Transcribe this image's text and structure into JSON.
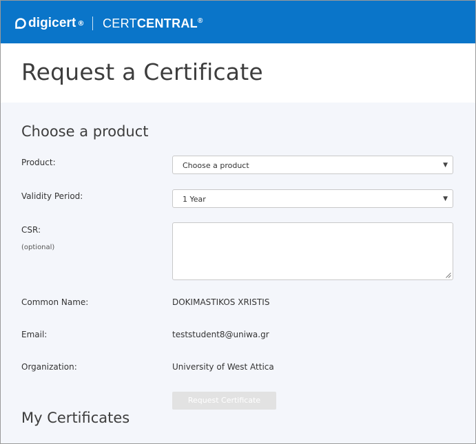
{
  "header": {
    "logo_text": "digicert",
    "logo_reg": "®",
    "brand_light": "CERT",
    "brand_bold": "CENTRAL",
    "brand_reg": "®",
    "bar_color": "#0a75c9"
  },
  "page": {
    "title": "Request a Certificate"
  },
  "product_section": {
    "title": "Choose a product",
    "product_label": "Product:",
    "product_value": "Choose a product",
    "validity_label": "Validity Period:",
    "validity_value": "1 Year",
    "csr_label": "CSR:",
    "csr_optional": "(optional)",
    "common_name_label": "Common Name:",
    "common_name_value": "DOKIMASTIKOS XRISTIS",
    "email_label": "Email:",
    "email_value": "teststudent8@uniwa.gr",
    "organization_label": "Organization:",
    "organization_value": "University of West Attica",
    "submit_label": "Request Certificate"
  },
  "my_certificates": {
    "title": "My Certificates"
  },
  "icons": {
    "dropdown": "chevron-down-icon",
    "resize": "resize-grip-icon"
  }
}
